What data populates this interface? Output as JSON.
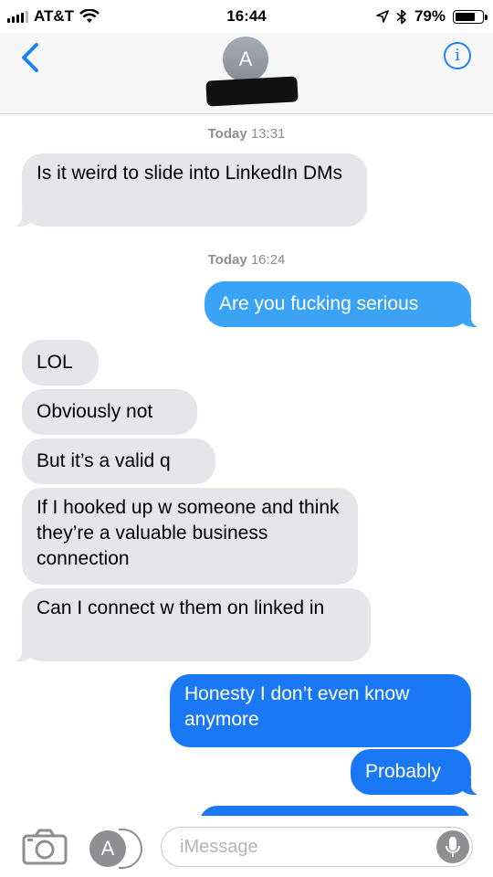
{
  "status_bar": {
    "carrier": "AT&T",
    "time": "16:44",
    "battery_text": "79%",
    "battery_level": 0.79,
    "icons": [
      "signal-bars-icon",
      "wifi-icon",
      "location-arrow-icon",
      "bluetooth-icon",
      "battery-icon"
    ]
  },
  "header": {
    "avatar_initial": "A",
    "icons": [
      "back-chevron-icon",
      "info-icon"
    ]
  },
  "timestamps": [
    {
      "day": "Today",
      "time": "13:31"
    },
    {
      "day": "Today",
      "time": "16:24"
    }
  ],
  "messages": [
    {
      "from": "them",
      "text": "Is it weird to slide into LinkedIn DMs"
    },
    {
      "from": "me",
      "text": "Are you fucking serious"
    },
    {
      "from": "them",
      "text": "LOL"
    },
    {
      "from": "them",
      "text": "Obviously not"
    },
    {
      "from": "them",
      "text": "But it’s a valid q"
    },
    {
      "from": "them",
      "text": "If I hooked up w someone and think they’re a valuable business connection"
    },
    {
      "from": "them",
      "text": "Can I connect w them on linked in"
    },
    {
      "from": "me",
      "text": "Honesty I don’t even know anymore"
    },
    {
      "from": "me",
      "text": "Probably"
    }
  ],
  "input_bar": {
    "placeholder": "iMessage",
    "icons": [
      "camera-icon",
      "app-store-icon",
      "microphone-icon"
    ]
  },
  "colors": {
    "incoming": "#e5e5ea",
    "outgoing_light": "#3aa3f5",
    "outgoing": "#1a78f4",
    "accent": "#1a82fb"
  }
}
